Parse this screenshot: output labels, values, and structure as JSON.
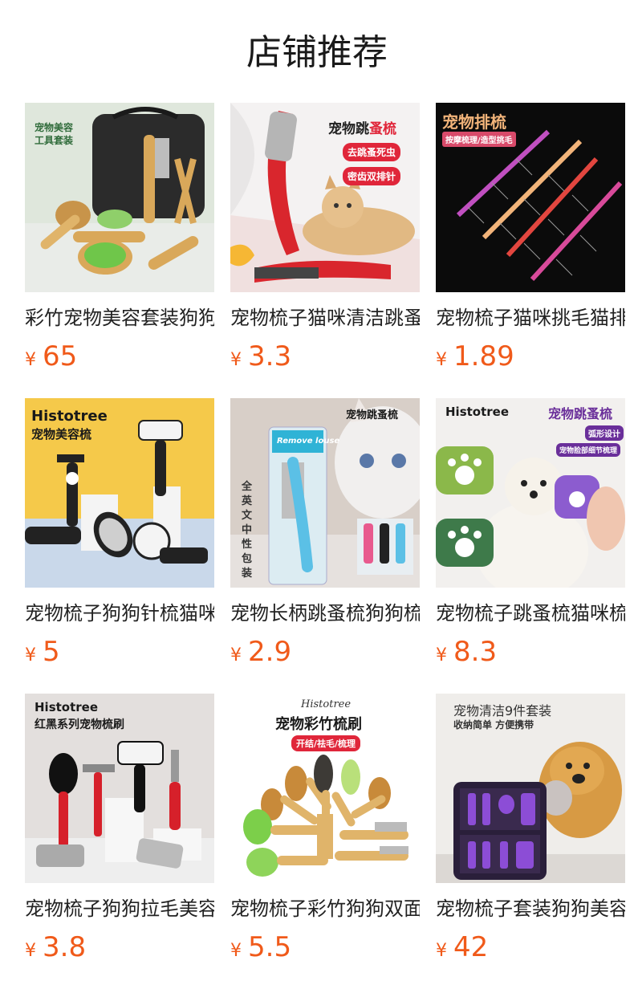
{
  "header": {
    "title": "店铺推荐"
  },
  "currency_symbol": "¥",
  "accent_color": "#f05a1a",
  "products": [
    {
      "name": "彩竹宠物美容套装狗狗梳子",
      "price": "65",
      "image_text": {
        "title": "宠物美容",
        "subtitle": "工具套装"
      },
      "icon": "bamboo-grooming-kit-image"
    },
    {
      "name": "宠物梳子猫咪清洁跳蚤梳",
      "price": "3.3",
      "image_text": {
        "title_a": "宠物跳",
        "title_b": "蚤梳",
        "tag1": "去跳蚤死虫",
        "tag2": "密齿双排针"
      },
      "icon": "flea-comb-cat-image"
    },
    {
      "name": "宠物梳子猫咪挑毛猫排梳",
      "price": "1.89",
      "image_text": {
        "title": "宠物排梳",
        "subtitle": "按摩梳理/造型挑毛"
      },
      "icon": "row-comb-image"
    },
    {
      "name": "宠物梳子狗狗针梳猫咪梳",
      "price": "5",
      "image_text": {
        "brand": "Histotree",
        "title": "宠物美容梳"
      },
      "icon": "grooming-brush-set-image"
    },
    {
      "name": "宠物长柄跳蚤梳狗狗梳子",
      "price": "2.9",
      "image_text": {
        "title": "宠物跳蚤梳",
        "label": "Remove louse",
        "side": "全英文中性包装"
      },
      "icon": "long-handle-flea-comb-image"
    },
    {
      "name": "宠物梳子跳蚤梳猫咪梳子",
      "price": "8.3",
      "image_text": {
        "brand": "Histotree",
        "title": "宠物跳蚤梳",
        "tag1": "弧形设计",
        "tag2": "宠物脸部细节梳理"
      },
      "icon": "paw-flea-comb-image"
    },
    {
      "name": "宠物梳子狗狗拉毛美容梳",
      "price": "3.8",
      "image_text": {
        "brand": "Histotree",
        "title": "红黑系列宠物梳刷"
      },
      "icon": "red-black-brush-set-image"
    },
    {
      "name": "宠物梳子彩竹狗狗双面梳",
      "price": "5.5",
      "image_text": {
        "brand": "Histotree",
        "title": "宠物彩竹梳刷",
        "tag": "开结/祛毛/梳理"
      },
      "icon": "bamboo-brush-fan-image"
    },
    {
      "name": "宠物梳子套装狗狗美容梳",
      "price": "42",
      "image_text": {
        "title": "宠物清洁9件套装",
        "subtitle": "收纳简单 方便携带"
      },
      "icon": "cleaning-kit-dog-image"
    }
  ]
}
